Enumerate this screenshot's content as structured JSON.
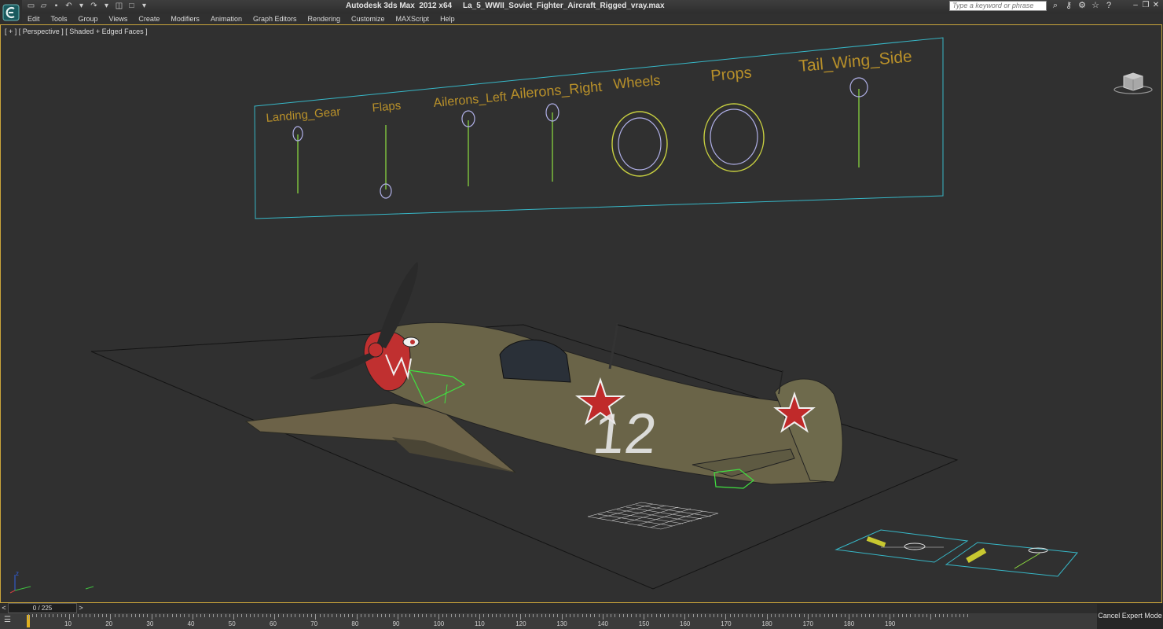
{
  "app": {
    "title": "Autodesk 3ds Max  2012 x64     La_5_WWII_Soviet_Fighter_Aircraft_Rigged_vray.max",
    "search_placeholder": "Type a keyword or phrase"
  },
  "menu": [
    "Edit",
    "Tools",
    "Group",
    "Views",
    "Create",
    "Modifiers",
    "Animation",
    "Graph Editors",
    "Rendering",
    "Customize",
    "MAXScript",
    "Help"
  ],
  "viewport": {
    "label": "[ + ] [ Perspective ] [ Shaded + Edged Faces ]",
    "controls": [
      "Landing_Gear",
      "Flaps",
      "Ailerons_Left",
      "Ailerons_Right",
      "Wheels",
      "Props",
      "Tail_Wing_Side"
    ],
    "aircraft_number": "12",
    "axis_z": "z"
  },
  "timeline": {
    "frame_display": "0 / 225",
    "prev": "<",
    "next": ">",
    "ticks": [
      "10",
      "20",
      "30",
      "40",
      "50",
      "60",
      "70",
      "80",
      "90",
      "100",
      "110",
      "120",
      "130",
      "140",
      "150",
      "160",
      "170",
      "180",
      "170",
      "180",
      "190"
    ]
  },
  "status": {
    "cancel_expert": "Cancel Expert Mode"
  },
  "colors": {
    "viewport_border": "#c9a43a",
    "control_text": "#b8902a",
    "panel_line": "#37b8c8",
    "control_green": "#8fe040"
  }
}
